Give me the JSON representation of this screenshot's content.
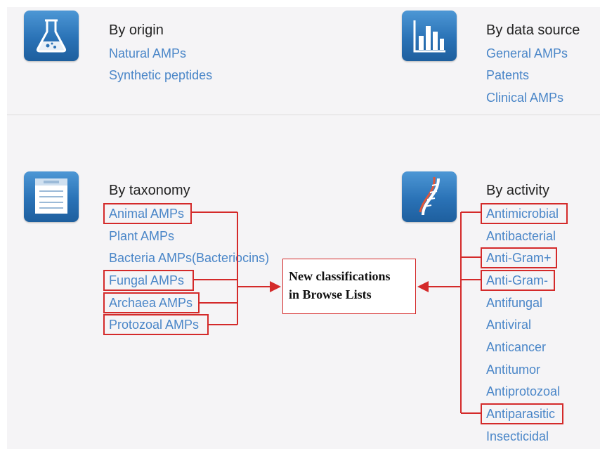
{
  "colors": {
    "link": "#4a86c8",
    "heading": "#222222",
    "highlight": "#d42a2a",
    "icon_blue": "#2a72b6",
    "panel": "#f5f4f6"
  },
  "origin": {
    "icon": "flask-icon",
    "title": "By origin",
    "items": [
      "Natural AMPs",
      "Synthetic peptides"
    ]
  },
  "data_source": {
    "icon": "bar-chart-icon",
    "title": "By data source",
    "items": [
      "General AMPs",
      "Patents",
      "Clinical AMPs"
    ]
  },
  "taxonomy": {
    "icon": "document-icon",
    "title": "By taxonomy",
    "items": [
      "Animal AMPs",
      "Plant AMPs",
      "Bacteria AMPs(Bacteriocins)",
      "Fungal AMPs",
      "Archaea AMPs",
      "Protozoal AMPs"
    ]
  },
  "activity": {
    "icon": "dna-icon",
    "title": "By activity",
    "items": [
      "Antimicrobial",
      "Antibacterial",
      "Anti-Gram+",
      "Anti-Gram-",
      "Antifungal",
      "Antiviral",
      "Anticancer",
      "Antitumor",
      "Antiprotozoal",
      "Antiparasitic",
      "Insecticidal"
    ]
  },
  "callout": {
    "line1": "New classifications",
    "line2": "in Browse Lists"
  }
}
